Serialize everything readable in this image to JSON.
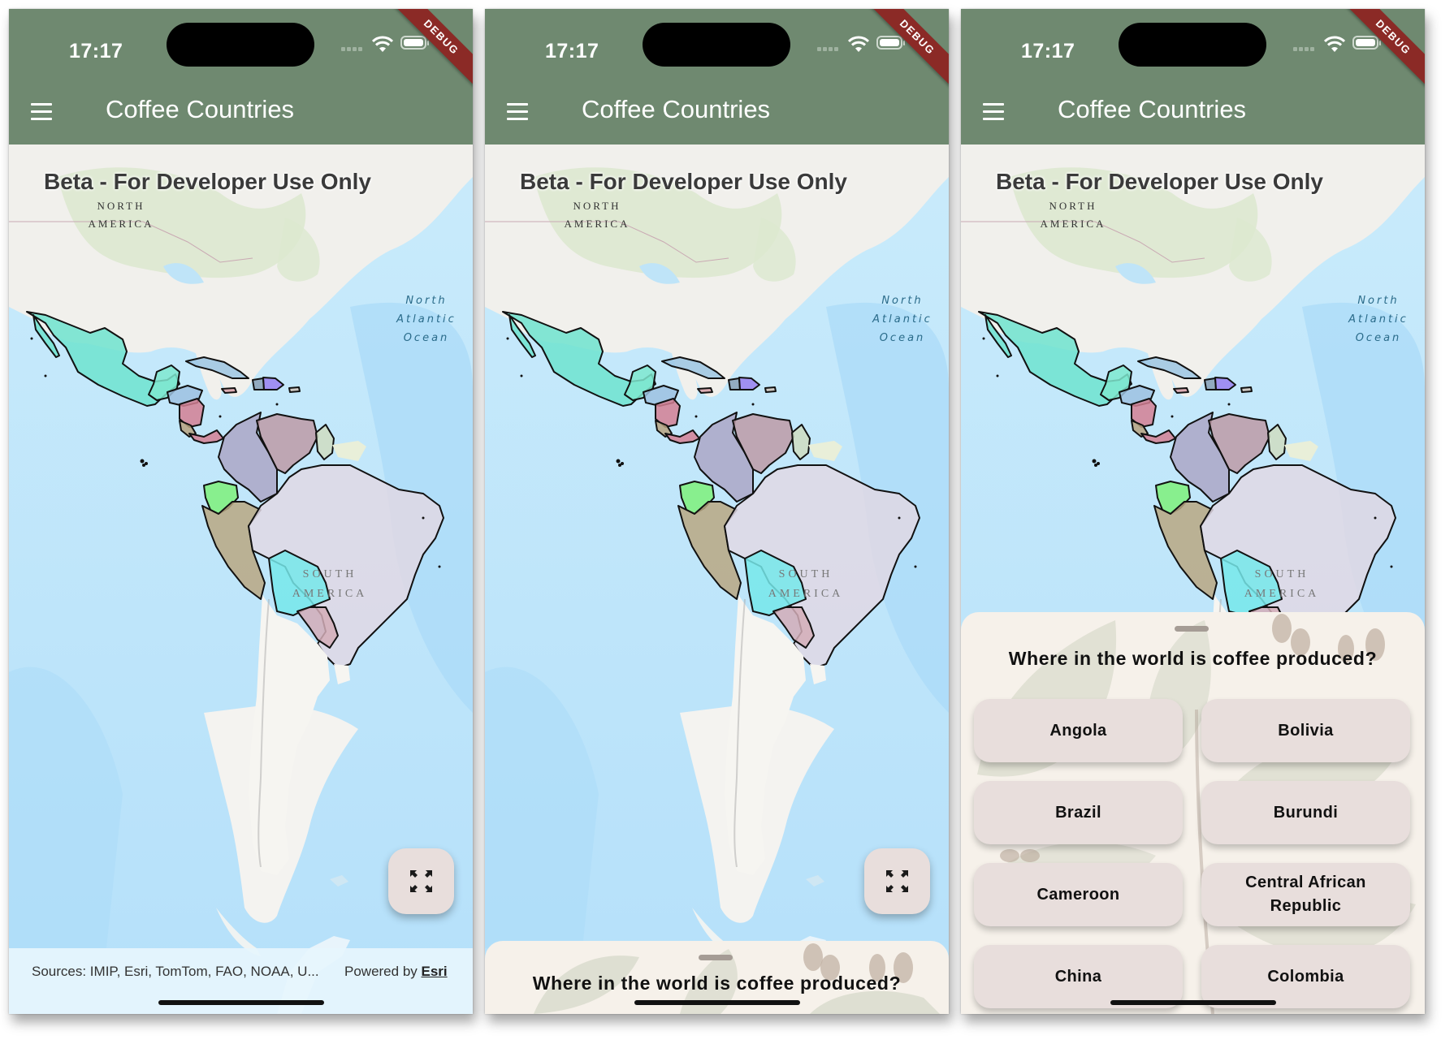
{
  "screens": [
    {
      "id": "map-only",
      "sheet_state": "hidden"
    },
    {
      "id": "sheet-collapsed",
      "sheet_state": "collapsed"
    },
    {
      "id": "sheet-expanded",
      "sheet_state": "expanded"
    }
  ],
  "status_bar": {
    "time": "17:17",
    "wifi_icon": "wifi-icon",
    "battery_icon": "battery-icon",
    "signal_icon": "cellular-signal-dots-icon",
    "debug_banner": "DEBUG"
  },
  "app_bar": {
    "menu_icon": "hamburger-menu-icon",
    "title": "Coffee Countries",
    "background_color": "#6f8970"
  },
  "map": {
    "watermark": "Beta - For Developer Use Only",
    "labels": {
      "north_america_1": "NORTH",
      "north_america_2": "AMERICA",
      "ocean_1": "North",
      "ocean_2": "Atlantic",
      "ocean_3": "Ocean",
      "south_america_1": "SOUTH",
      "south_america_2": "AMERICA"
    },
    "fullscreen_button_icon": "fullscreen-expand-icon",
    "attribution": {
      "sources": "Sources: IMIP, Esri, TomTom, FAO, NOAA, U...",
      "powered_by": "Powered by ",
      "esri_link": "Esri"
    },
    "highlight_colors": {
      "mexico": "#6fe3cf",
      "guatemala": "#7fe8cf",
      "honduras": "#9ec1e0",
      "nicaragua": "#d47f93",
      "costa_rica": "#b7a27f",
      "panama": "#d47f93",
      "cuba": "#9cc5e3",
      "dominican_republic": "#9a80f0",
      "haiti": "#8aa0b5",
      "jamaica": "#d8a0a8",
      "puerto_rico": "#d3c5bb",
      "colombia": "#aca6c6",
      "venezuela": "#bd9aa6",
      "guyana": "#cfdcc1",
      "ecuador": "#7ef07a",
      "peru": "#b8a781",
      "brazil": "#e0d8e4",
      "bolivia": "#76e8ea",
      "paraguay": "#d4adb7"
    }
  },
  "quiz_sheet": {
    "question": "Where in the world is coffee produced?",
    "answers": [
      "Angola",
      "Bolivia",
      "Brazil",
      "Burundi",
      "Cameroon",
      "Central African Republic",
      "China",
      "Colombia"
    ]
  }
}
